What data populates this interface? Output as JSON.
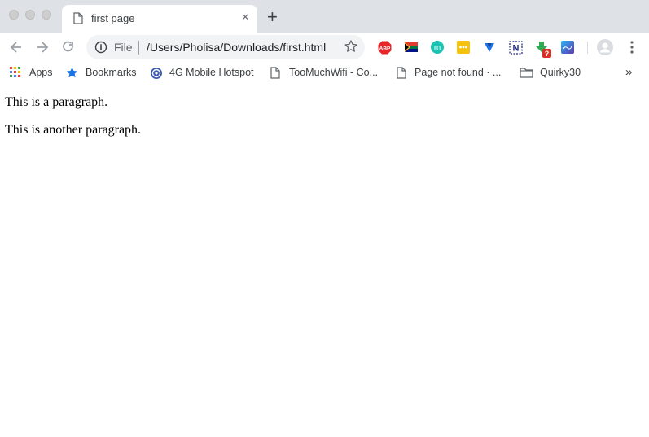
{
  "tab": {
    "title": "first page",
    "close": "×",
    "new_tab": "+"
  },
  "omnibox": {
    "scheme_label": "File",
    "url": "/Users/Pholisa/Downloads/first.html"
  },
  "bookmarks": [
    {
      "label": "Apps",
      "icon": "apps-grid-icon"
    },
    {
      "label": "Bookmarks",
      "icon": "star-icon"
    },
    {
      "label": "4G Mobile Hotspot",
      "icon": "hotspot-globe-icon"
    },
    {
      "label": "TooMuchWifi - Co...",
      "icon": "page-icon"
    },
    {
      "label": "Page not found · ...",
      "icon": "page-icon"
    },
    {
      "label": "Quirky30",
      "icon": "folder-icon"
    }
  ],
  "bookmarks_overflow": "»",
  "extensions": [
    {
      "name": "adblock-plus-icon",
      "text": "ABP"
    },
    {
      "name": "south-africa-flag-icon"
    },
    {
      "name": "extension-m-icon",
      "text": "m"
    },
    {
      "name": "extension-dots-icon"
    },
    {
      "name": "extension-v-icon"
    },
    {
      "name": "extension-n-icon",
      "text": "N"
    },
    {
      "name": "download-badge-icon",
      "text": "?"
    },
    {
      "name": "extension-blue-icon"
    }
  ],
  "page": {
    "paragraphs": [
      "This is a paragraph.",
      "This is another paragraph."
    ]
  },
  "colors": {
    "tabstrip": "#dee1e6",
    "omnibox": "#f1f3f4",
    "abp_red": "#e8262a",
    "m_teal": "#1cc3b2",
    "dots_yellow": "#f4c20d",
    "n_blue": "#1a237e",
    "download_green": "#34a853"
  }
}
